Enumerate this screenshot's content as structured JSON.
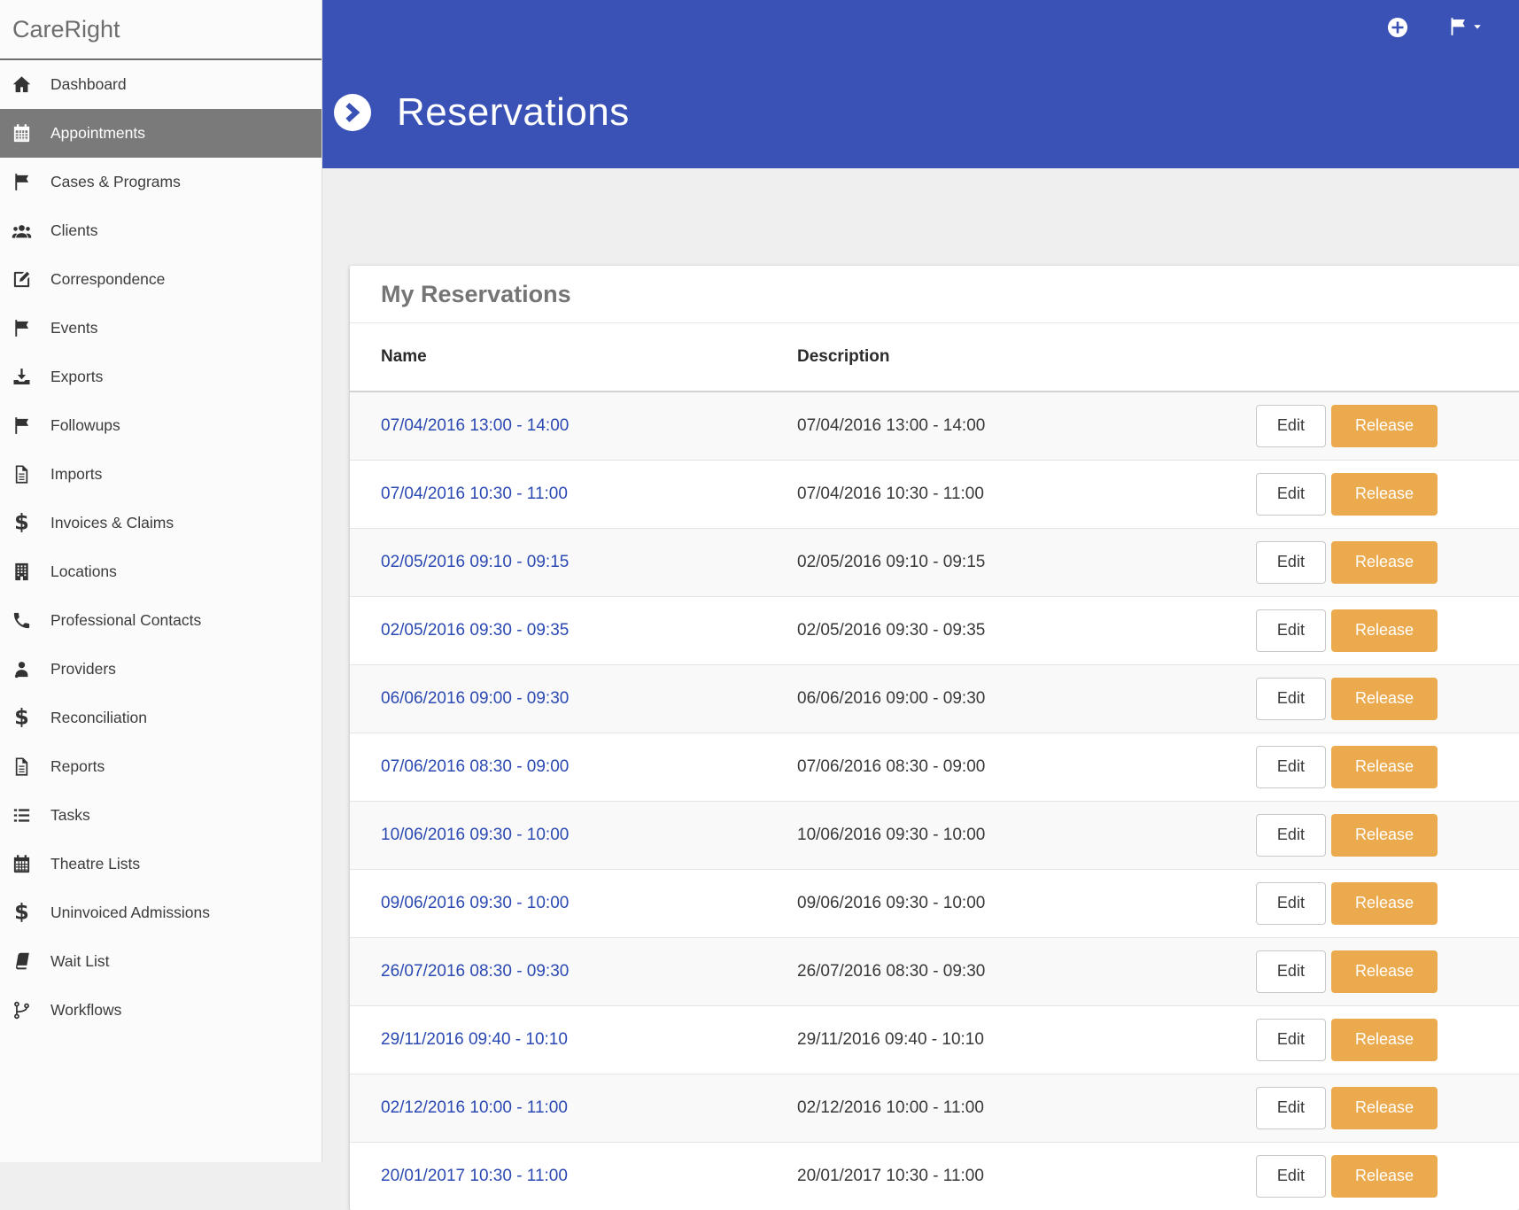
{
  "app": {
    "brand": "CareRight"
  },
  "colors": {
    "header_blue": "#3a51b5",
    "release_orange": "#ecaa4e",
    "link_blue": "#2b49b2",
    "active_item_gray": "#7a7a7a"
  },
  "sidebar": {
    "items": [
      {
        "label": "Dashboard",
        "icon": "#icon-home",
        "icon_name": "home-icon",
        "name": "sidebar-item-dashboard",
        "state": ""
      },
      {
        "label": "Appointments",
        "icon": "#icon-calendar",
        "icon_name": "calendar-icon",
        "name": "sidebar-item-appointments",
        "state": "active"
      },
      {
        "label": "Cases & Programs",
        "icon": "#icon-flag",
        "icon_name": "flag-icon",
        "name": "sidebar-item-cases-programs",
        "state": ""
      },
      {
        "label": "Clients",
        "icon": "#icon-users",
        "icon_name": "users-icon",
        "name": "sidebar-item-clients",
        "state": ""
      },
      {
        "label": "Correspondence",
        "icon": "#icon-edit",
        "icon_name": "pencil-square-icon",
        "name": "sidebar-item-correspondence",
        "state": ""
      },
      {
        "label": "Events",
        "icon": "#icon-flag",
        "icon_name": "flag-icon",
        "name": "sidebar-item-events",
        "state": ""
      },
      {
        "label": "Exports",
        "icon": "#icon-download",
        "icon_name": "download-icon",
        "name": "sidebar-item-exports",
        "state": ""
      },
      {
        "label": "Followups",
        "icon": "#icon-flag",
        "icon_name": "flag-icon",
        "name": "sidebar-item-followups",
        "state": ""
      },
      {
        "label": "Imports",
        "icon": "#icon-file",
        "icon_name": "file-icon",
        "name": "sidebar-item-imports",
        "state": ""
      },
      {
        "label": "Invoices & Claims",
        "icon": "#icon-dollar",
        "icon_name": "dollar-icon",
        "name": "sidebar-item-invoices-claims",
        "state": ""
      },
      {
        "label": "Locations",
        "icon": "#icon-building",
        "icon_name": "building-icon",
        "name": "sidebar-item-locations",
        "state": ""
      },
      {
        "label": "Professional Contacts",
        "icon": "#icon-phone",
        "icon_name": "phone-icon",
        "name": "sidebar-item-professional-contacts",
        "state": ""
      },
      {
        "label": "Providers",
        "icon": "#icon-user-md",
        "icon_name": "provider-icon",
        "name": "sidebar-item-providers",
        "state": ""
      },
      {
        "label": "Reconciliation",
        "icon": "#icon-dollar",
        "icon_name": "dollar-icon",
        "name": "sidebar-item-reconciliation",
        "state": ""
      },
      {
        "label": "Reports",
        "icon": "#icon-file",
        "icon_name": "file-icon",
        "name": "sidebar-item-reports",
        "state": ""
      },
      {
        "label": "Tasks",
        "icon": "#icon-list",
        "icon_name": "list-icon",
        "name": "sidebar-item-tasks",
        "state": ""
      },
      {
        "label": "Theatre Lists",
        "icon": "#icon-calendar",
        "icon_name": "calendar-icon",
        "name": "sidebar-item-theatre-lists",
        "state": ""
      },
      {
        "label": "Uninvoiced Admissions",
        "icon": "#icon-dollar",
        "icon_name": "dollar-icon",
        "name": "sidebar-item-uninvoiced-admissions",
        "state": ""
      },
      {
        "label": "Wait List",
        "icon": "#icon-book",
        "icon_name": "book-icon",
        "name": "sidebar-item-wait-list",
        "state": ""
      },
      {
        "label": "Workflows",
        "icon": "#icon-branch",
        "icon_name": "code-branch-icon",
        "name": "sidebar-item-workflows",
        "state": ""
      }
    ]
  },
  "header": {
    "title": "Reservations"
  },
  "card": {
    "title": "My Reservations"
  },
  "table": {
    "columns": {
      "name": "Name",
      "description": "Description"
    },
    "edit_label": "Edit",
    "release_label": "Release",
    "rows": [
      {
        "name": "07/04/2016 13:00 - 14:00",
        "description": "07/04/2016 13:00 - 14:00"
      },
      {
        "name": "07/04/2016 10:30 - 11:00",
        "description": "07/04/2016 10:30 - 11:00"
      },
      {
        "name": "02/05/2016 09:10 - 09:15",
        "description": "02/05/2016 09:10 - 09:15"
      },
      {
        "name": "02/05/2016 09:30 - 09:35",
        "description": "02/05/2016 09:30 - 09:35"
      },
      {
        "name": "06/06/2016 09:00 - 09:30",
        "description": "06/06/2016 09:00 - 09:30"
      },
      {
        "name": "07/06/2016 08:30 - 09:00",
        "description": "07/06/2016 08:30 - 09:00"
      },
      {
        "name": "10/06/2016 09:30 - 10:00",
        "description": "10/06/2016 09:30 - 10:00"
      },
      {
        "name": "09/06/2016 09:30 - 10:00",
        "description": "09/06/2016 09:30 - 10:00"
      },
      {
        "name": "26/07/2016 08:30 - 09:30",
        "description": "26/07/2016 08:30 - 09:30"
      },
      {
        "name": "29/11/2016 09:40 - 10:10",
        "description": "29/11/2016 09:40 - 10:10"
      },
      {
        "name": "02/12/2016 10:00 - 11:00",
        "description": "02/12/2016 10:00 - 11:00"
      },
      {
        "name": "20/01/2017 10:30 - 11:00",
        "description": "20/01/2017 10:30 - 11:00"
      }
    ]
  }
}
